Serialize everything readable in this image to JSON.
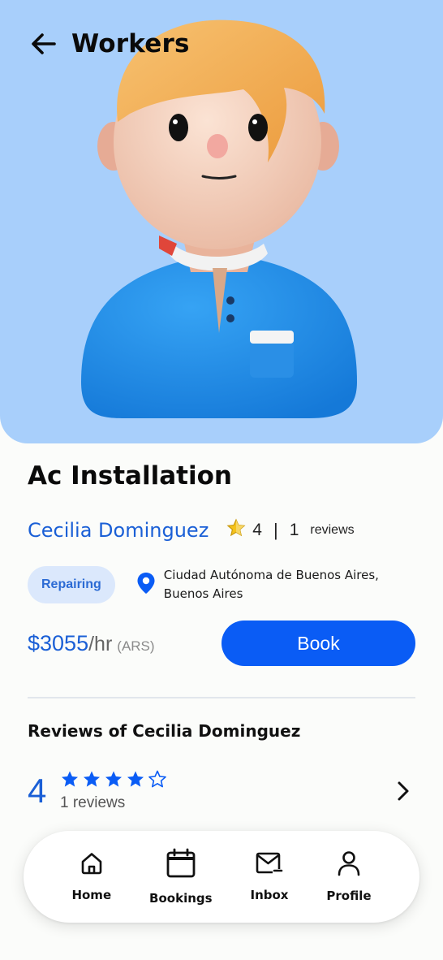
{
  "header": {
    "title": "Workers",
    "back_icon": "arrow-left-icon"
  },
  "colors": {
    "hero_bg": "#a8cffb",
    "accent": "#1a5fd6",
    "button": "#0a5cf5",
    "chip_bg": "#dbe8fc",
    "star": "#f4c21a"
  },
  "service": {
    "title": "Ac Installation"
  },
  "worker": {
    "name": "Cecilia Dominguez",
    "rating": "4",
    "separator": "|",
    "review_count": "1",
    "review_word": "reviews"
  },
  "category_chip": "Repairing",
  "location": {
    "line1": "Ciudad Autónoma de Buenos Aires,",
    "line2": "Buenos Aires",
    "icon": "map-pin-icon"
  },
  "pricing": {
    "amount": "$3055",
    "unit": "/hr",
    "currency": "(ARS)"
  },
  "book_button": "Book",
  "reviews": {
    "title": "Reviews of Cecilia Dominguez",
    "score": "4",
    "stars_filled": 4,
    "stars_total": 5,
    "count_text": "1 reviews"
  },
  "nav": [
    {
      "label": "Home",
      "icon": "home-icon"
    },
    {
      "label": "Bookings",
      "icon": "calendar-icon"
    },
    {
      "label": "Inbox",
      "icon": "mail-icon"
    },
    {
      "label": "Profile",
      "icon": "user-icon"
    }
  ]
}
